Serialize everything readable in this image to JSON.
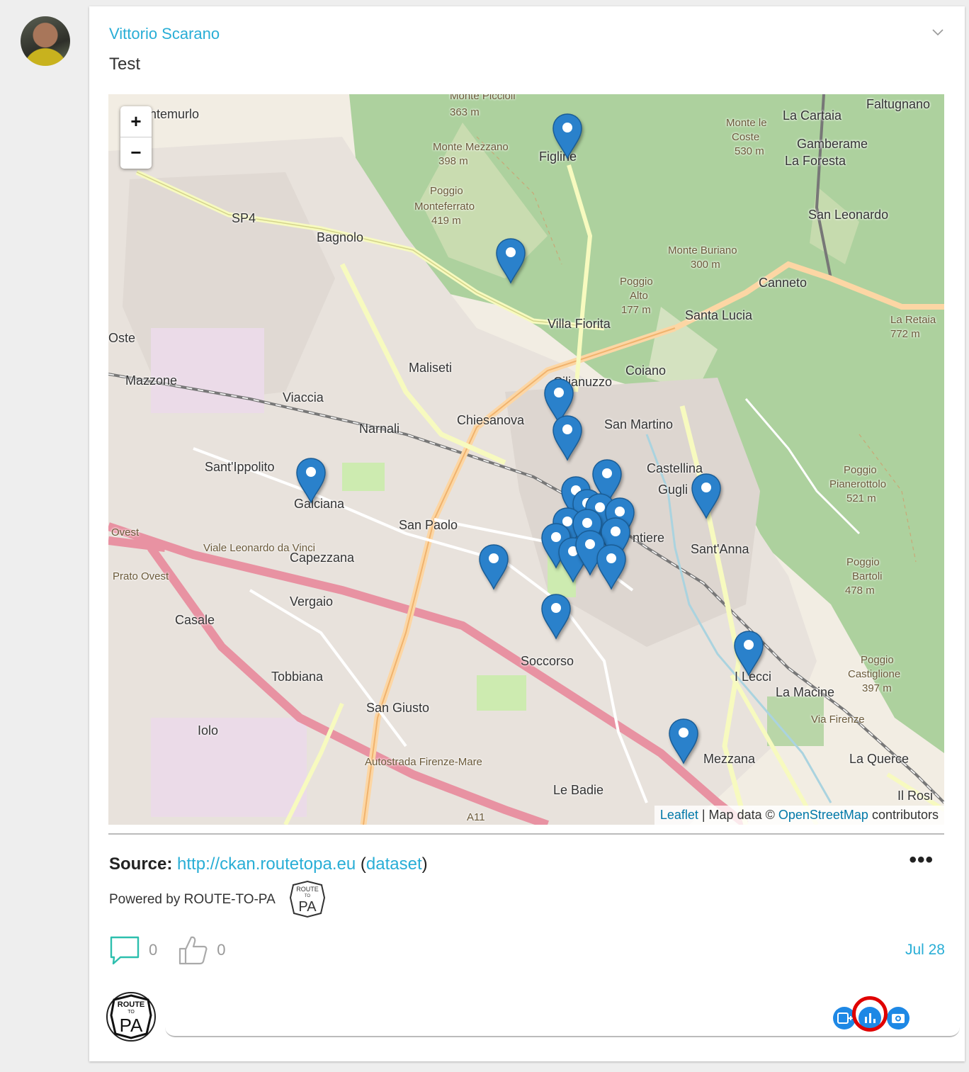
{
  "post": {
    "author": "Vittorio Scarano",
    "text": "Test"
  },
  "map": {
    "zoom_in": "+",
    "zoom_out": "−",
    "attribution": {
      "leaflet": "Leaflet",
      "separator": " | Map data © ",
      "osm": "OpenStreetMap",
      "suffix": " contributors"
    },
    "labels": [
      "Monte Piccioli",
      "363 m",
      "ntemurlo",
      "Monte Mezzano",
      "398 m",
      "Figline",
      "Monte le",
      "Coste",
      "530 m",
      "La Cartaia",
      "Faltugnano",
      "Gamberame",
      "La Foresta",
      "SP4",
      "Poggio",
      "Monteferrato",
      "419 m",
      "Bagnolo",
      "San Leonardo",
      "Monte Buriano",
      "300 m",
      "Poggio",
      "Alto",
      "177 m",
      "Canneto",
      "Villa Fiorita",
      "Santa Lucia",
      "La Retaia",
      "772 m",
      "Oste",
      "Maliseti",
      "Coiano",
      "Mazzone",
      "Cilianuzzo",
      "Viaccia",
      "Chiesanova",
      "San Martino",
      "Narnali",
      "Sant'Ippolito",
      "Castellina",
      "Poggio",
      "Pianerottolo",
      "521 m",
      "Galciana",
      "Gugli",
      "San Paolo",
      "Ovest",
      "ntiere",
      "Viale Leonardo da Vinci",
      "Sant'Anna",
      "Capezzana",
      "Prato Ovest",
      "Poggio",
      "Bartoli",
      "478 m",
      "Vergaio",
      "Casale",
      "Soccorso",
      "Poggio",
      "Castiglione",
      "397 m",
      "I Lecci",
      "Tobbiana",
      "La Macine",
      "San Giusto",
      "Iolo",
      "Mezzana",
      "La Querce",
      "Le Badie",
      "Il Rosi",
      "A11",
      "Autostrada Firenze-Mare",
      "Via Firenze"
    ],
    "marker_count": 22,
    "marker_color": "#2a81cb"
  },
  "source": {
    "label": "Source:",
    "url": "http://ckan.routetopa.eu",
    "paren_open": " (",
    "dataset": "dataset",
    "paren_close": ")"
  },
  "powered_by": "Powered by ROUTE-TO-PA",
  "logo": {
    "top": "ROUTE",
    "middle": "TO",
    "bottom": "PA"
  },
  "actions": {
    "comments_count": "0",
    "likes_count": "0",
    "date": "Jul 28"
  },
  "more_label": "•••",
  "colors": {
    "accent": "#29aed6",
    "tool": "#1e88e5",
    "highlight": "#e00000"
  }
}
